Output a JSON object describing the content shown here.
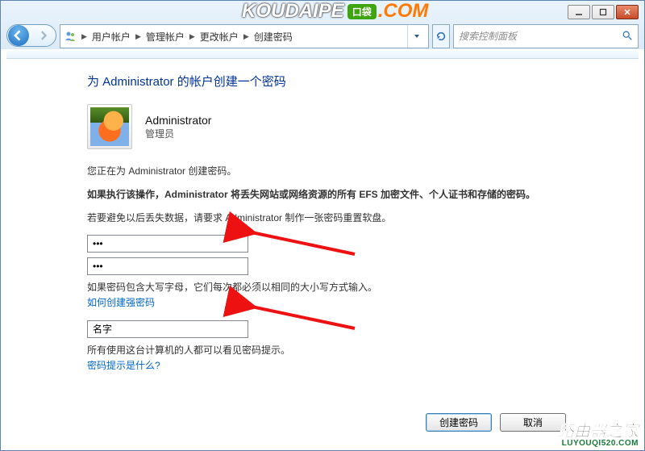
{
  "window": {
    "min_tooltip": "最小化",
    "max_tooltip": "最大化",
    "close_tooltip": "关闭"
  },
  "breadcrumb": {
    "items": [
      "用户帐户",
      "管理帐户",
      "更改帐户",
      "创建密码"
    ]
  },
  "search": {
    "placeholder": "搜索控制面板"
  },
  "page": {
    "title": "为 Administrator 的帐户创建一个密码",
    "user_name": "Administrator",
    "user_role": "管理员",
    "intro": "您正在为 Administrator 创建密码。",
    "warning": "如果执行该操作，Administrator 将丢失网站或网络资源的所有 EFS 加密文件、个人证书和存储的密码。",
    "advice": "若要避免以后丢失数据，请要求 Administrator 制作一张密码重置软盘。",
    "pw_value": "•••",
    "pw_confirm_value": "•••",
    "caps_hint": "如果密码包含大写字母，它们每次都必须以相同的大小写方式输入。",
    "strong_pw_link": "如何创建强密码",
    "hint_value": "名字",
    "hint_visible_note": "所有使用这台计算机的人都可以看见密码提示。",
    "hint_what_link": "密码提示是什么?",
    "btn_create": "创建密码",
    "btn_cancel": "取消"
  },
  "overlays": {
    "koudaipe_main": "KOUDAIPE",
    "koudaipe_badge": "口袋",
    "koudaipe_suffix": ".COM",
    "router_cn": "路由器之家",
    "router_en": "LUYOUQI520.COM"
  }
}
